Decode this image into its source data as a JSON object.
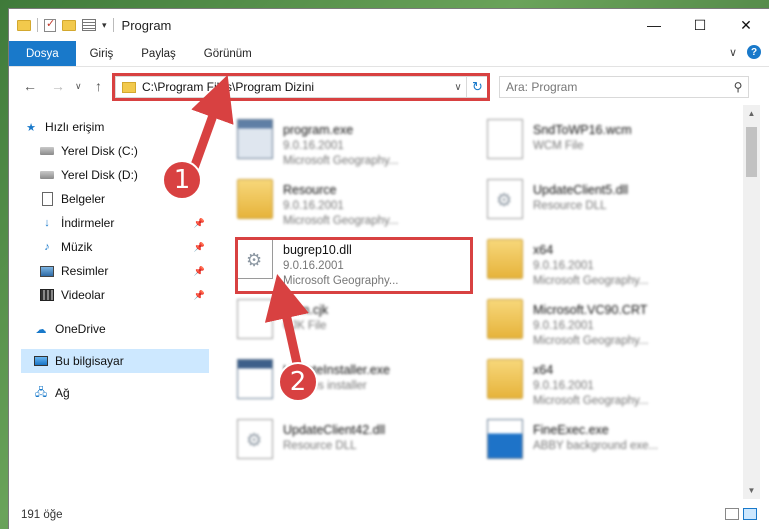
{
  "window": {
    "title": "Program",
    "controls": {
      "minimize": "—",
      "maximize": "☐",
      "close": "✕"
    }
  },
  "ribbon": {
    "tabs": [
      "Dosya",
      "Giriş",
      "Paylaş",
      "Görünüm"
    ],
    "help": "?"
  },
  "address": {
    "path": "C:\\Program Files\\Program Dizini"
  },
  "search": {
    "placeholder": "Ara: Program"
  },
  "sidebar": {
    "items": [
      {
        "label": "Hızlı erişim",
        "icon": "star-icon"
      },
      {
        "label": "Yerel Disk (C:)",
        "icon": "drive-icon"
      },
      {
        "label": "Yerel Disk (D:)",
        "icon": "drive-icon"
      },
      {
        "label": "Belgeler",
        "icon": "document-icon"
      },
      {
        "label": "İndirmeler",
        "icon": "download-icon"
      },
      {
        "label": "Müzik",
        "icon": "music-icon"
      },
      {
        "label": "Resimler",
        "icon": "picture-icon"
      },
      {
        "label": "Videolar",
        "icon": "video-icon"
      },
      {
        "label": "OneDrive",
        "icon": "cloud-icon"
      },
      {
        "label": "Bu bilgisayar",
        "icon": "computer-icon"
      },
      {
        "label": "Ağ",
        "icon": "network-icon"
      }
    ]
  },
  "files": [
    {
      "name": "program.exe",
      "version": "9.0.16.2001",
      "description": "Microsoft Geography...",
      "icon": "exe-icon"
    },
    {
      "name": "SndToWP16.wcm",
      "version": "WCM File",
      "description": "",
      "icon": "file-icon"
    },
    {
      "name": "Resource",
      "version": "9.0.16.2001",
      "description": "Microsoft Geography...",
      "icon": "folder-icon"
    },
    {
      "name": "UpdateClient5.dll",
      "version": "Resource DLL",
      "description": "",
      "icon": "dll-icon"
    },
    {
      "name": "bugrep10.dll",
      "version": "9.0.16.2001",
      "description": "Microsoft Geography...",
      "icon": "dll-icon"
    },
    {
      "name": "x64",
      "version": "9.0.16.2001",
      "description": "Microsoft Geography...",
      "icon": "folder-icon"
    },
    {
      "name": "lcom.cjk",
      "version": "CJK File",
      "description": "",
      "icon": "file-icon"
    },
    {
      "name": "Microsoft.VC90.CRT",
      "version": "9.0.16.2001",
      "description": "Microsoft Geography...",
      "icon": "folder-icon"
    },
    {
      "name": "UpdateInstaller.exe",
      "version": "updates installer",
      "description": "",
      "icon": "exe-icon"
    },
    {
      "name": "x64",
      "version": "9.0.16.2001",
      "description": "Microsoft Geography...",
      "icon": "folder-icon"
    },
    {
      "name": "UpdateClient42.dll",
      "version": "Resource DLL",
      "description": "",
      "icon": "dll-icon"
    },
    {
      "name": "FineExec.exe",
      "version": "ABBY background exe...",
      "description": "",
      "icon": "exe-icon"
    }
  ],
  "status": {
    "count": "191 öğe"
  },
  "callouts": [
    "1",
    "2"
  ],
  "colors": {
    "accent": "#1979ca",
    "highlight": "#d84141",
    "selection": "#cde8ff"
  }
}
